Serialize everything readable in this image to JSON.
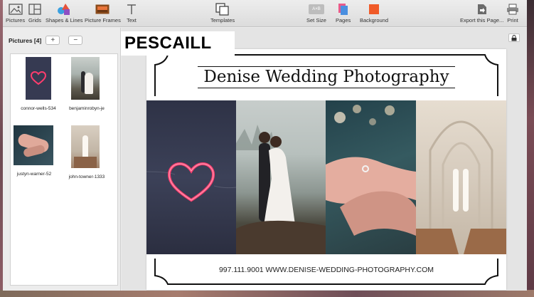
{
  "toolbar": {
    "items": [
      {
        "label": "Pictures",
        "icon": "pictures-icon"
      },
      {
        "label": "Grids",
        "icon": "grids-icon"
      },
      {
        "label": "Shapes & Lines",
        "icon": "shapes-lines-icon"
      },
      {
        "label": "Picture Frames",
        "icon": "picture-frames-icon"
      },
      {
        "label": "Text",
        "icon": "text-icon"
      },
      {
        "label": "Templates",
        "icon": "templates-icon"
      },
      {
        "label": "Set Size",
        "icon": "set-size-icon",
        "icon_text": "A×B"
      },
      {
        "label": "Pages",
        "icon": "pages-icon"
      },
      {
        "label": "Background",
        "icon": "background-icon",
        "color": "#f05a28"
      },
      {
        "label": "Export this Page...",
        "icon": "export-icon"
      },
      {
        "label": "Print",
        "icon": "print-icon"
      }
    ]
  },
  "sidebar": {
    "title": "Pictures [4]",
    "add_label": "+",
    "remove_label": "−",
    "pictures": [
      {
        "caption": "connor-wells-534"
      },
      {
        "caption": "benjaminrobyn-je"
      },
      {
        "caption": "justyn-warner-52"
      },
      {
        "caption": "john-towner-1333"
      }
    ]
  },
  "overlay": {
    "label": "PESCAILL"
  },
  "page": {
    "title": "Denise Wedding Photography",
    "footer": "997.111.9001 WWW.DENISE-WEDDING-PHOTOGRAPHY.COM"
  },
  "colors": {
    "accent": "#f05a28",
    "neon": "#ff3d6e"
  }
}
